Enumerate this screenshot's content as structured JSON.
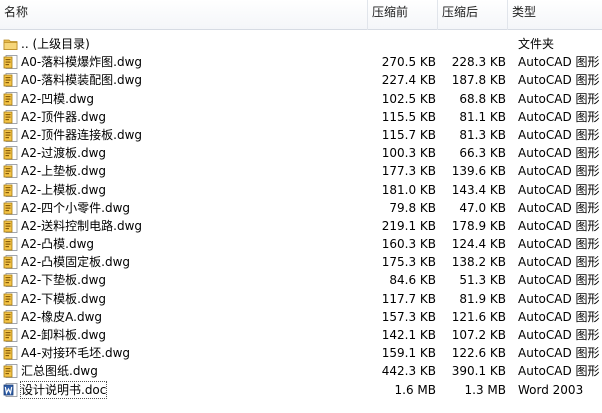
{
  "columns": {
    "name": "名称",
    "size": "压缩前",
    "packed": "压缩后",
    "type": "类型"
  },
  "rows": [
    {
      "name": ".. (上级目录)",
      "size": "",
      "packed": "",
      "type": "文件夹",
      "icon": "folder-icon"
    },
    {
      "name": "A0-落料模爆炸图.dwg",
      "size": "270.5 KB",
      "packed": "228.3 KB",
      "type": "AutoCAD 图形",
      "icon": "dwg-file-icon"
    },
    {
      "name": "A0-落料模装配图.dwg",
      "size": "227.4 KB",
      "packed": "187.8 KB",
      "type": "AutoCAD 图形",
      "icon": "dwg-file-icon"
    },
    {
      "name": "A2-凹模.dwg",
      "size": "102.5 KB",
      "packed": "68.8 KB",
      "type": "AutoCAD 图形",
      "icon": "dwg-file-icon"
    },
    {
      "name": "A2-顶件器.dwg",
      "size": "115.5 KB",
      "packed": "81.1 KB",
      "type": "AutoCAD 图形",
      "icon": "dwg-file-icon"
    },
    {
      "name": "A2-顶件器连接板.dwg",
      "size": "115.7 KB",
      "packed": "81.3 KB",
      "type": "AutoCAD 图形",
      "icon": "dwg-file-icon"
    },
    {
      "name": "A2-过渡板.dwg",
      "size": "100.3 KB",
      "packed": "66.3 KB",
      "type": "AutoCAD 图形",
      "icon": "dwg-file-icon"
    },
    {
      "name": "A2-上垫板.dwg",
      "size": "177.3 KB",
      "packed": "139.6 KB",
      "type": "AutoCAD 图形",
      "icon": "dwg-file-icon"
    },
    {
      "name": "A2-上模板.dwg",
      "size": "181.0 KB",
      "packed": "143.4 KB",
      "type": "AutoCAD 图形",
      "icon": "dwg-file-icon"
    },
    {
      "name": "A2-四个小零件.dwg",
      "size": "79.8 KB",
      "packed": "47.0 KB",
      "type": "AutoCAD 图形",
      "icon": "dwg-file-icon"
    },
    {
      "name": "A2-送料控制电路.dwg",
      "size": "219.1 KB",
      "packed": "178.9 KB",
      "type": "AutoCAD 图形",
      "icon": "dwg-file-icon"
    },
    {
      "name": "A2-凸模.dwg",
      "size": "160.3 KB",
      "packed": "124.4 KB",
      "type": "AutoCAD 图形",
      "icon": "dwg-file-icon"
    },
    {
      "name": "A2-凸模固定板.dwg",
      "size": "175.3 KB",
      "packed": "138.2 KB",
      "type": "AutoCAD 图形",
      "icon": "dwg-file-icon"
    },
    {
      "name": "A2-下垫板.dwg",
      "size": "84.6 KB",
      "packed": "51.3 KB",
      "type": "AutoCAD 图形",
      "icon": "dwg-file-icon"
    },
    {
      "name": "A2-下模板.dwg",
      "size": "117.7 KB",
      "packed": "81.9 KB",
      "type": "AutoCAD 图形",
      "icon": "dwg-file-icon"
    },
    {
      "name": "A2-橡皮A.dwg",
      "size": "157.3 KB",
      "packed": "121.6 KB",
      "type": "AutoCAD 图形",
      "icon": "dwg-file-icon"
    },
    {
      "name": "A2-卸料板.dwg",
      "size": "142.1 KB",
      "packed": "107.2 KB",
      "type": "AutoCAD 图形",
      "icon": "dwg-file-icon"
    },
    {
      "name": "A4-对接环毛坯.dwg",
      "size": "159.1 KB",
      "packed": "122.6 KB",
      "type": "AutoCAD 图形",
      "icon": "dwg-file-icon"
    },
    {
      "name": "汇总图纸.dwg",
      "size": "442.3 KB",
      "packed": "390.1 KB",
      "type": "AutoCAD 图形",
      "icon": "dwg-file-icon"
    },
    {
      "name": "设计说明书.doc",
      "size": "1.6 MB",
      "packed": "1.3 MB",
      "type": "Word 2003",
      "icon": "word-doc-icon",
      "selected": true
    }
  ]
}
